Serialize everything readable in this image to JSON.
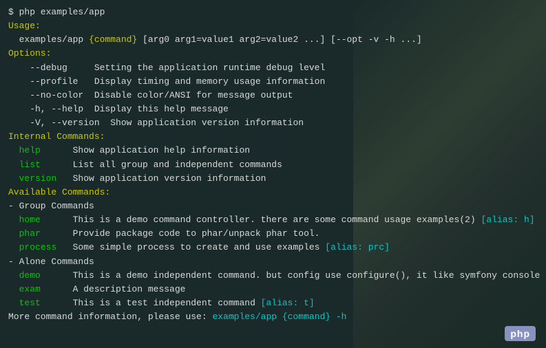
{
  "terminal": {
    "lines": [
      {
        "id": "cmd-line",
        "parts": [
          {
            "text": "$ php examples/app",
            "class": "color-white"
          }
        ]
      },
      {
        "id": "usage-label",
        "parts": [
          {
            "text": "Usage:",
            "class": "color-yellow"
          }
        ]
      },
      {
        "id": "usage-line",
        "parts": [
          {
            "text": "  examples/app ",
            "class": "color-white"
          },
          {
            "text": "{command}",
            "class": "color-yellow"
          },
          {
            "text": " [arg0 arg1=value1 arg2=value2 ...] [--opt -v -h ...]",
            "class": "color-white"
          }
        ]
      },
      {
        "id": "blank1",
        "parts": [
          {
            "text": "",
            "class": ""
          }
        ]
      },
      {
        "id": "options-label",
        "parts": [
          {
            "text": "Options:",
            "class": "color-yellow"
          }
        ]
      },
      {
        "id": "opt-debug",
        "parts": [
          {
            "text": "    --debug     Setting the application runtime debug level",
            "class": "color-white"
          }
        ]
      },
      {
        "id": "opt-profile",
        "parts": [
          {
            "text": "    --profile   Display timing and memory usage information",
            "class": "color-white"
          }
        ]
      },
      {
        "id": "opt-nocolor",
        "parts": [
          {
            "text": "    --no-color  Disable color/ANSI for message output",
            "class": "color-white"
          }
        ]
      },
      {
        "id": "opt-help",
        "parts": [
          {
            "text": "    -h, --help  Display this help message",
            "class": "color-white"
          }
        ]
      },
      {
        "id": "opt-version",
        "parts": [
          {
            "text": "    -V, --version  Show application version information",
            "class": "color-white"
          }
        ]
      },
      {
        "id": "blank2",
        "parts": [
          {
            "text": "",
            "class": ""
          }
        ]
      },
      {
        "id": "internal-label",
        "parts": [
          {
            "text": "Internal Commands:",
            "class": "color-yellow"
          }
        ]
      },
      {
        "id": "int-help",
        "parts": [
          {
            "text": "  ",
            "class": ""
          },
          {
            "text": "help   ",
            "class": "color-green"
          },
          {
            "text": "   Show application help information",
            "class": "color-white"
          }
        ]
      },
      {
        "id": "int-list",
        "parts": [
          {
            "text": "  ",
            "class": ""
          },
          {
            "text": "list   ",
            "class": "color-green"
          },
          {
            "text": "   List all group and independent commands",
            "class": "color-white"
          }
        ]
      },
      {
        "id": "int-version",
        "parts": [
          {
            "text": "  ",
            "class": ""
          },
          {
            "text": "version",
            "class": "color-green"
          },
          {
            "text": "   Show application version information",
            "class": "color-white"
          }
        ]
      },
      {
        "id": "blank3",
        "parts": [
          {
            "text": "",
            "class": ""
          }
        ]
      },
      {
        "id": "available-label",
        "parts": [
          {
            "text": "Available Commands:",
            "class": "color-yellow"
          }
        ]
      },
      {
        "id": "blank4",
        "parts": [
          {
            "text": "",
            "class": ""
          }
        ]
      },
      {
        "id": "group-label",
        "parts": [
          {
            "text": "- Group Commands",
            "class": "color-white"
          }
        ]
      },
      {
        "id": "grp-home",
        "parts": [
          {
            "text": "  ",
            "class": ""
          },
          {
            "text": "home   ",
            "class": "color-green"
          },
          {
            "text": "   This is a demo command controller. there are some command usage examples(2) ",
            "class": "color-white"
          },
          {
            "text": "[alias: h]",
            "class": "color-cyan"
          }
        ]
      },
      {
        "id": "grp-phar",
        "parts": [
          {
            "text": "  ",
            "class": ""
          },
          {
            "text": "phar   ",
            "class": "color-green"
          },
          {
            "text": "   Provide package code to phar/unpack phar tool.",
            "class": "color-white"
          }
        ]
      },
      {
        "id": "grp-process",
        "parts": [
          {
            "text": "  ",
            "class": ""
          },
          {
            "text": "process",
            "class": "color-green"
          },
          {
            "text": "   Some simple process to create and use examples ",
            "class": "color-white"
          },
          {
            "text": "[alias: prc]",
            "class": "color-cyan"
          }
        ]
      },
      {
        "id": "blank5",
        "parts": [
          {
            "text": "",
            "class": ""
          }
        ]
      },
      {
        "id": "alone-label",
        "parts": [
          {
            "text": "- Alone Commands",
            "class": "color-white"
          }
        ]
      },
      {
        "id": "alone-demo",
        "parts": [
          {
            "text": "  ",
            "class": ""
          },
          {
            "text": "demo   ",
            "class": "color-green"
          },
          {
            "text": "   This is a demo independent command. but config use configure(), it like symfony console",
            "class": "color-white"
          }
        ]
      },
      {
        "id": "alone-exam",
        "parts": [
          {
            "text": "  ",
            "class": ""
          },
          {
            "text": "exam   ",
            "class": "color-green"
          },
          {
            "text": "   A description message",
            "class": "color-white"
          }
        ]
      },
      {
        "id": "alone-test",
        "parts": [
          {
            "text": "  ",
            "class": ""
          },
          {
            "text": "test   ",
            "class": "color-green"
          },
          {
            "text": "   This is a test independent command ",
            "class": "color-white"
          },
          {
            "text": "[alias: t]",
            "class": "color-cyan"
          }
        ]
      },
      {
        "id": "blank6",
        "parts": [
          {
            "text": "",
            "class": ""
          }
        ]
      },
      {
        "id": "more-info",
        "parts": [
          {
            "text": "More command information, please use: ",
            "class": "color-white"
          },
          {
            "text": "examples/app {command} -h",
            "class": "color-cyan"
          }
        ]
      }
    ]
  },
  "php_badge": {
    "text": "php"
  }
}
